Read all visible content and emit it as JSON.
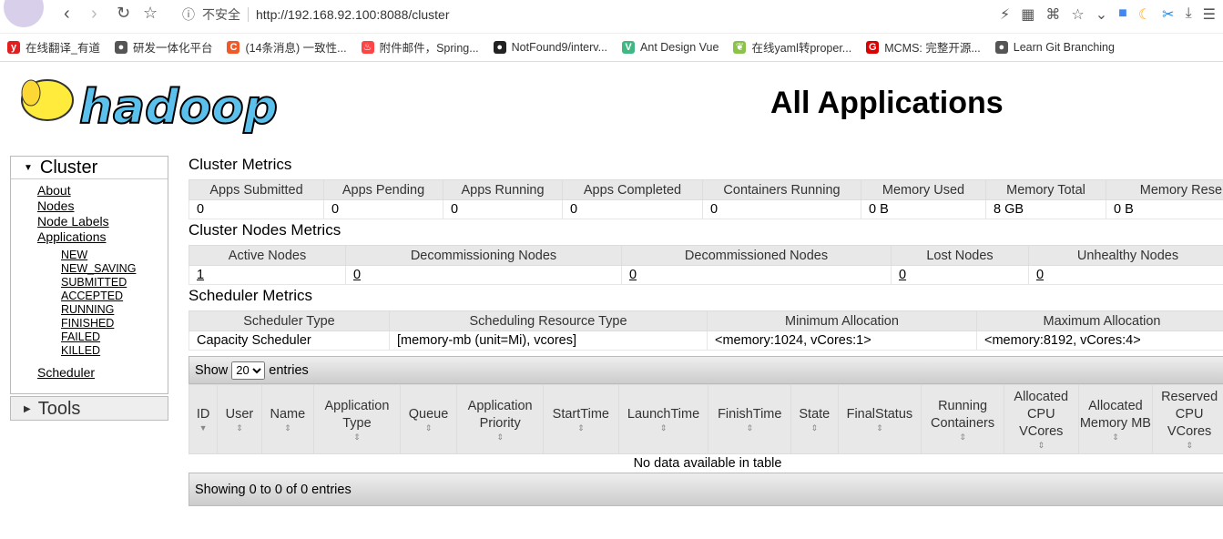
{
  "browser": {
    "url": "http://192.168.92.100:8088/cluster",
    "security": "不安全",
    "bookmarks": [
      {
        "label": "在线翻译_有道",
        "color": "#e02020",
        "glyph": "y"
      },
      {
        "label": "研发一体化平台",
        "color": "#555",
        "glyph": "●"
      },
      {
        "label": "(14条消息) 一致性...",
        "color": "#f05a28",
        "glyph": "C"
      },
      {
        "label": "附件邮件，Spring...",
        "color": "#f44",
        "glyph": "♨"
      },
      {
        "label": "NotFound9/interv...",
        "color": "#222",
        "glyph": "●"
      },
      {
        "label": "Ant Design Vue",
        "color": "#41b883",
        "glyph": "V"
      },
      {
        "label": "在线yaml转proper...",
        "color": "#8bc34a",
        "glyph": "❦"
      },
      {
        "label": "MCMS: 完整开源...",
        "color": "#d00",
        "glyph": "G"
      },
      {
        "label": "Learn Git Branching",
        "color": "#555",
        "glyph": "●"
      }
    ]
  },
  "logo_text": "hadoop",
  "page_title": "All Applications",
  "sidebar": {
    "cluster_label": "Cluster",
    "links": [
      "About",
      "Nodes",
      "Node Labels",
      "Applications"
    ],
    "app_states": [
      "NEW",
      "NEW_SAVING",
      "SUBMITTED",
      "ACCEPTED",
      "RUNNING",
      "FINISHED",
      "FAILED",
      "KILLED"
    ],
    "scheduler": "Scheduler",
    "tools_label": "Tools"
  },
  "cluster_metrics": {
    "title": "Cluster Metrics",
    "headers": [
      "Apps Submitted",
      "Apps Pending",
      "Apps Running",
      "Apps Completed",
      "Containers Running",
      "Memory Used",
      "Memory Total",
      "Memory Reserved"
    ],
    "values": [
      "0",
      "0",
      "0",
      "0",
      "0",
      "0 B",
      "8 GB",
      "0 B"
    ]
  },
  "node_metrics": {
    "title": "Cluster Nodes Metrics",
    "headers": [
      "Active Nodes",
      "Decommissioning Nodes",
      "Decommissioned Nodes",
      "Lost Nodes",
      "Unhealthy Nodes"
    ],
    "values": [
      "1",
      "0",
      "0",
      "0",
      "0"
    ]
  },
  "scheduler_metrics": {
    "title": "Scheduler Metrics",
    "headers": [
      "Scheduler Type",
      "Scheduling Resource Type",
      "Minimum Allocation",
      "Maximum Allocation"
    ],
    "values": [
      "Capacity Scheduler",
      "[memory-mb (unit=Mi), vcores]",
      "<memory:1024, vCores:1>",
      "<memory:8192, vCores:4>"
    ]
  },
  "apps": {
    "show_label": "Show",
    "entries_label": "entries",
    "page_size": "20",
    "columns": [
      "ID",
      "User",
      "Name",
      "Application Type",
      "Queue",
      "Application Priority",
      "StartTime",
      "LaunchTime",
      "FinishTime",
      "State",
      "FinalStatus",
      "Running Containers",
      "Allocated CPU VCores",
      "Allocated Memory MB",
      "Reserved CPU VCores"
    ],
    "empty": "No data available in table",
    "footer": "Showing 0 to 0 of 0 entries"
  }
}
